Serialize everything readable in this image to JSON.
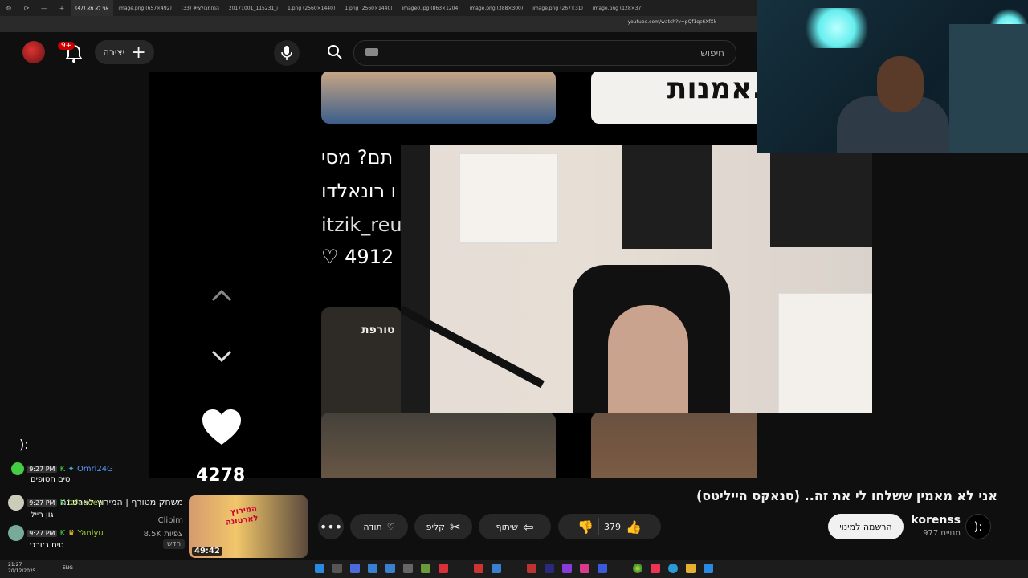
{
  "browser": {
    "tabs": [
      {
        "label": "אני לא מא (47)",
        "active": true
      },
      {
        "label": "image.png (657×492)"
      },
      {
        "label": "(33) #הנחמבולצי"
      },
      {
        "label": "20171001_115231_i"
      },
      {
        "label": "1.png (2560×1440)"
      },
      {
        "label": "1.png (2560×1440)"
      },
      {
        "label": "image0.jpg (863×1204)"
      },
      {
        "label": "image.png (388×300)"
      },
      {
        "label": "image.png (267×31)"
      },
      {
        "label": "image.png (128×37)"
      }
    ],
    "url": "youtube.com/watch?v=pQf1qc6XfXk"
  },
  "header": {
    "search_placeholder": "חיפוש",
    "create_label": "יצירה",
    "notif_count": "9+"
  },
  "video": {
    "tiktok_line1": "תם? מסי",
    "tiktok_line2": "ו רונאלדו",
    "tiktok_handle": "itzik_reu",
    "tiktok_likes": "4912",
    "thumb_text": "אמנות.",
    "thumb_text2": "טורפת",
    "like_count": "4278",
    "face_text": "):"
  },
  "chat": [
    {
      "time": "9:27 PM",
      "user": "Omri24G",
      "message": "טים חטופים",
      "user_color": "#5b9bff"
    },
    {
      "time": "9:27 PM",
      "user": "tzfaedea",
      "message": "גון רייל",
      "user_color": "#9acd32"
    },
    {
      "time": "9:27 PM",
      "user": "Yaniyu",
      "message": "טים ג׳ורג׳",
      "user_color": "#9acd32"
    }
  ],
  "below": {
    "title": "אני לא מאמין ששלחו לי את זה.. (סנאקס הייליטס)",
    "channel": "korenss",
    "subscribers": "977 מנויים",
    "channel_icon": "):",
    "subscribe_label": "הרשמה למינוי",
    "likes": "379",
    "share_label": "שיתוף",
    "clip_label": "קליפ",
    "thanks_label": "תודה"
  },
  "side_card": {
    "title": "משחק מטורף | המירוץ לארטונה",
    "channel": "Clipim",
    "views": "8.5K צפיות",
    "new_label": "חדש",
    "duration": "49:42",
    "thumb_text": "המירוץ לארטונה"
  },
  "taskbar": {
    "time": "21:27",
    "date": "20/12/2025",
    "lang": "ENG"
  },
  "colors": {
    "accent": "#cc0000",
    "background": "#0f0f0f"
  }
}
